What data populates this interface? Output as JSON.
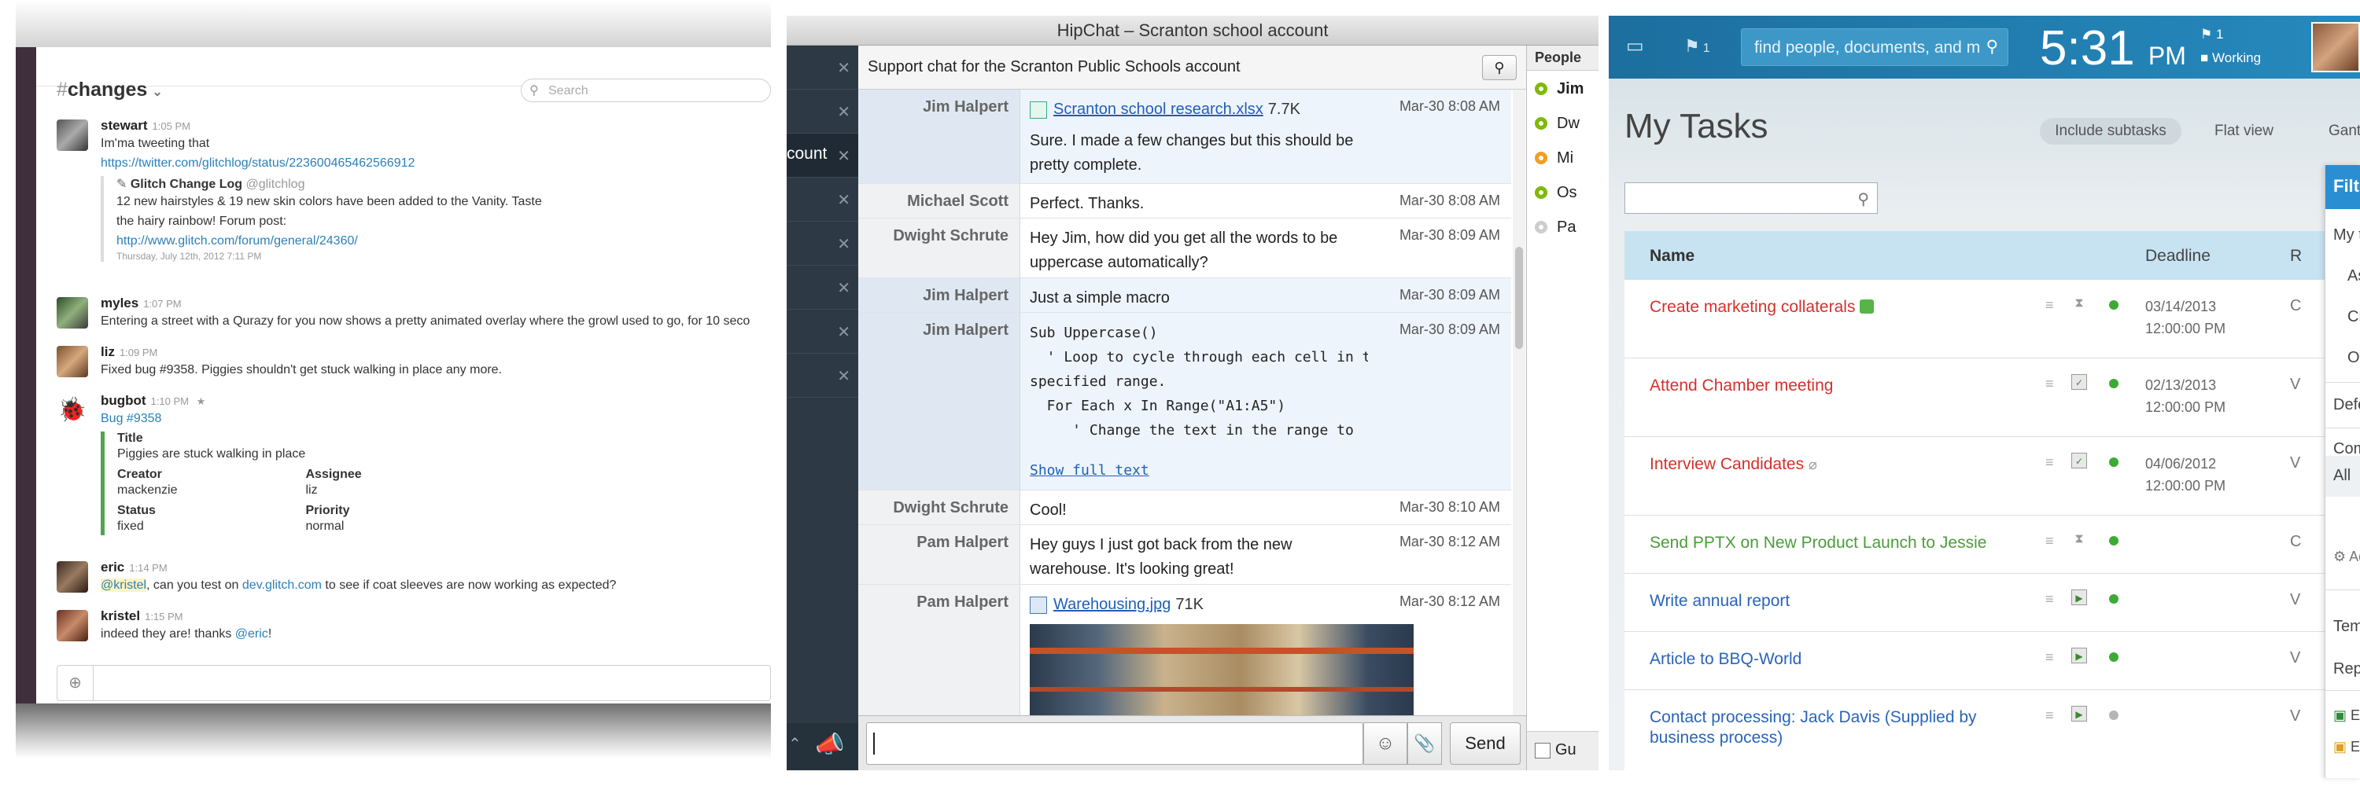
{
  "slack": {
    "channel": "changes",
    "channel_prefix": "#",
    "search_placeholder": "Search",
    "messages": [
      {
        "user": "stewart",
        "time": "1:05 PM",
        "text": "Im'ma tweeting that",
        "link": "https://twitter.com/glitchlog/status/223600465462566912",
        "quote": {
          "source": "Glitch Change Log",
          "handle": "@glitchlog",
          "line1": "12 new hairstyles & 19 new skin colors have been added to the Vanity. Taste",
          "line2": "the hairy rainbow! Forum post:",
          "link": "http://www.glitch.com/forum/general/24360/",
          "date": "Thursday, July 12th, 2012 7:11 PM"
        }
      },
      {
        "user": "myles",
        "time": "1:07 PM",
        "text": "Entering a street with a Qurazy for you now shows a pretty animated overlay where the growl used to go, for 10 seco"
      },
      {
        "user": "liz",
        "time": "1:09 PM",
        "text": "Fixed bug #9358. Piggies shouldn't get stuck walking in place any more."
      },
      {
        "user": "bugbot",
        "time": "1:10 PM",
        "link": "Bug #9358",
        "attachment": {
          "title_label": "Title",
          "title_value": "Piggies are stuck walking in place",
          "creator_label": "Creator",
          "creator_value": "mackenzie",
          "assignee_label": "Assignee",
          "assignee_value": "liz",
          "status_label": "Status",
          "status_value": "fixed",
          "priority_label": "Priority",
          "priority_value": "normal"
        }
      },
      {
        "user": "eric",
        "time": "1:14 PM",
        "mention": "@kristel",
        "text_a": ", can you test on ",
        "link": "dev.glitch.com",
        "text_b": " to see if coat sleeves are now working as expected?"
      },
      {
        "user": "kristel",
        "time": "1:15 PM",
        "text_a": "indeed they are! thanks ",
        "mention": "@eric",
        "text_b": "!"
      }
    ]
  },
  "hipchat": {
    "window_title": "HipChat – Scranton school account",
    "topic": "Support chat for the Scranton Public Schools account",
    "sidebar_active_label": "count",
    "messages": [
      {
        "who": "Jim Halpert",
        "time": "Mar-30 8:08 AM",
        "file": "Scranton school research.xlsx",
        "size": "7.7K",
        "text": "Sure. I made a few changes but this should be pretty complete."
      },
      {
        "who": "Michael Scott",
        "time": "Mar-30 8:08 AM",
        "text": "Perfect. Thanks."
      },
      {
        "who": "Dwight Schrute",
        "time": "Mar-30 8:09 AM",
        "text": "Hey Jim, how did you get all the words to be uppercase automatically?"
      },
      {
        "who": "Jim Halpert",
        "time": "Mar-30 8:09 AM",
        "text": "Just a simple macro"
      },
      {
        "who": "Jim Halpert",
        "time": "Mar-30 8:09 AM",
        "code": "Sub Uppercase()\n  ' Loop to cycle through each cell in the\nspecified range.\n  For Each x In Range(\"A1:A5\")\n     ' Change the text in the range to\nuppercase letters.",
        "show_full": "Show full text"
      },
      {
        "who": "Dwight Schrute",
        "time": "Mar-30 8:10 AM",
        "text": "Cool!"
      },
      {
        "who": "Pam Halpert",
        "time": "Mar-30 8:12 AM",
        "text": "Hey guys I just got back from the new warehouse. It's looking great!"
      },
      {
        "who": "Pam Halpert",
        "time": "Mar-30 8:12 AM",
        "file": "Warehousing.jpg",
        "size": "71K"
      }
    ],
    "send_label": "Send",
    "people_header": "People",
    "people": [
      {
        "name": "Jim",
        "status_color": "#7ab800"
      },
      {
        "name": "Dw",
        "status_color": "#7ab800"
      },
      {
        "name": "Mi",
        "status_color": "#f29b1d"
      },
      {
        "name": "Os",
        "status_color": "#7ab800"
      },
      {
        "name": "Pa",
        "status_color": "#cccccc"
      }
    ],
    "footer_checkbox_label": "Gu"
  },
  "bitrix": {
    "search_placeholder": "find people, documents, and m",
    "notifications_count": "1",
    "clock": "5:31",
    "clock_ampm": "PM",
    "status_top": "1",
    "status_working": "Working",
    "title": "My Tasks",
    "include_subtasks": "Include subtasks",
    "flat_view": "Flat view",
    "gantt": "Gant",
    "col_name": "Name",
    "col_deadline": "Deadline",
    "col_more": "R",
    "tasks": [
      {
        "name": "Create marketing collaterals",
        "color": "red",
        "deadline_date": "03/14/2013",
        "deadline_time": "12:00:00 PM",
        "tail": "C",
        "has_tag": true
      },
      {
        "name": "Attend Chamber meeting",
        "color": "red",
        "deadline_date": "02/13/2013",
        "deadline_time": "12:00:00 PM",
        "tail": "V"
      },
      {
        "name": "Interview Candidates",
        "color": "red",
        "deadline_date": "04/06/2012",
        "deadline_time": "12:00:00 PM",
        "tail": "V",
        "has_clip": true
      },
      {
        "name": "Send PPTX on New Product Launch to Jessie",
        "color": "green",
        "tail": "C"
      },
      {
        "name": "Write annual report",
        "color": "blue",
        "tail": "V"
      },
      {
        "name": "Article to BBQ-World",
        "color": "blue",
        "tail": "V"
      },
      {
        "name": "Contact processing: Jack Davis (Supplied by business process)",
        "color": "blue",
        "tail": "V"
      }
    ],
    "filter_menu": {
      "header": "Filter",
      "items": [
        "My ta",
        "Ass",
        "Cre",
        "Ob",
        "Defer",
        "Comp",
        "All",
        "Add",
        "Templ",
        "Repor",
        "Ex",
        "Ex"
      ]
    }
  }
}
